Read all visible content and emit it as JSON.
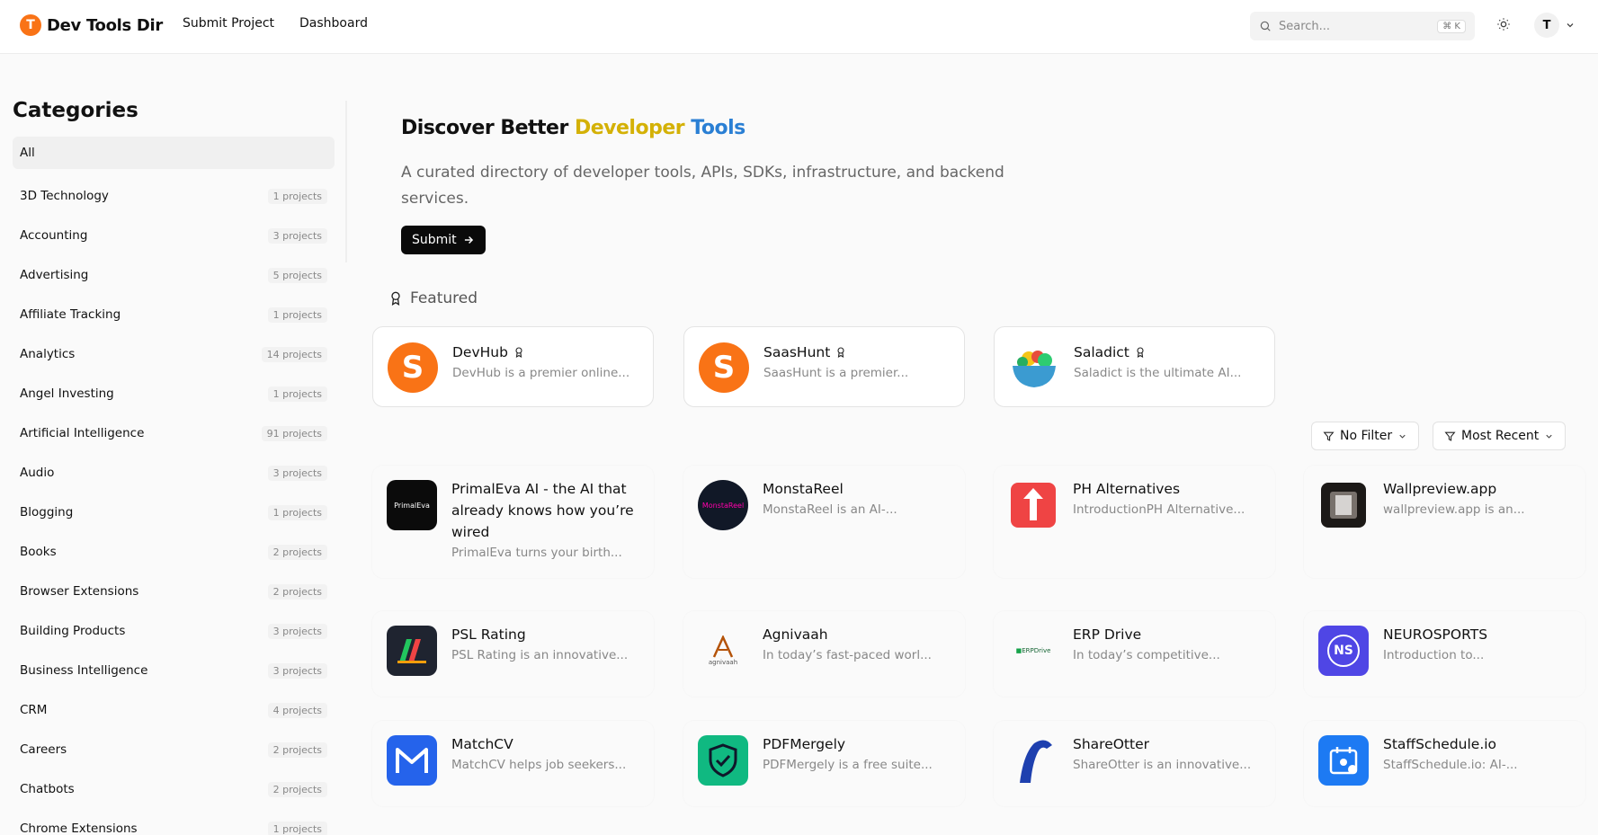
{
  "nav": {
    "logo_letter": "T",
    "logo_text": "Dev Tools Dir",
    "links": [
      "Submit Project",
      "Dashboard"
    ],
    "search_placeholder": "Search...",
    "search_shortcut": "⌘ K",
    "user_initial": "T"
  },
  "sidebar": {
    "title": "Categories",
    "items": [
      {
        "label": "All",
        "count": ""
      },
      {
        "label": "3D Technology",
        "count": "1 projects"
      },
      {
        "label": "Accounting",
        "count": "3 projects"
      },
      {
        "label": "Advertising",
        "count": "5 projects"
      },
      {
        "label": "Affiliate Tracking",
        "count": "1 projects"
      },
      {
        "label": "Analytics",
        "count": "14 projects"
      },
      {
        "label": "Angel Investing",
        "count": "1 projects"
      },
      {
        "label": "Artificial Intelligence",
        "count": "91 projects"
      },
      {
        "label": "Audio",
        "count": "3 projects"
      },
      {
        "label": "Blogging",
        "count": "1 projects"
      },
      {
        "label": "Books",
        "count": "2 projects"
      },
      {
        "label": "Browser Extensions",
        "count": "2 projects"
      },
      {
        "label": "Building Products",
        "count": "3 projects"
      },
      {
        "label": "Business Intelligence",
        "count": "3 projects"
      },
      {
        "label": "CRM",
        "count": "4 projects"
      },
      {
        "label": "Careers",
        "count": "2 projects"
      },
      {
        "label": "Chatbots",
        "count": "2 projects"
      },
      {
        "label": "Chrome Extensions",
        "count": "1 projects"
      }
    ]
  },
  "hero": {
    "title_plain": "Discover Better ",
    "title_word1": "Developer",
    "title_word2": " Tools",
    "subtitle": "A curated directory of developer tools, APIs, SDKs, infrastructure, and backend services.",
    "submit_label": "Submit"
  },
  "featured": {
    "label": "Featured",
    "items": [
      {
        "name": "DevHub",
        "desc": "DevHub is a premier online..."
      },
      {
        "name": "SaasHunt",
        "desc": "SaasHunt is a premier..."
      },
      {
        "name": "Saladict",
        "desc": "Saladict is the ultimate AI..."
      }
    ]
  },
  "filters": {
    "filter_label": "No Filter",
    "sort_label": "Most Recent"
  },
  "projects": [
    {
      "name": "PrimalEva AI - the AI that already knows how you’re wired",
      "desc": "PrimalEva turns your birth...",
      "icon_text": "PrimalEva"
    },
    {
      "name": "MonstaReel",
      "desc": "MonstaReel is an AI-...",
      "icon_text": "MonstaReel"
    },
    {
      "name": "PH Alternatives",
      "desc": "IntroductionPH Alternative...",
      "icon_text": ""
    },
    {
      "name": "Wallpreview.app",
      "desc": "wallpreview.app is an...",
      "icon_text": ""
    },
    {
      "name": "PSL Rating",
      "desc": "PSL Rating is an innovative...",
      "icon_text": ""
    },
    {
      "name": "Agnivaah",
      "desc": "In today’s fast-paced worl...",
      "icon_text": "agnivaah"
    },
    {
      "name": "ERP Drive",
      "desc": "In today’s competitive...",
      "icon_text": "ERPDrive"
    },
    {
      "name": "NEUROSPORTS",
      "desc": "Introduction to...",
      "icon_text": "NS"
    },
    {
      "name": "MatchCV",
      "desc": "MatchCV helps job seekers...",
      "icon_text": ""
    },
    {
      "name": "PDFMergely",
      "desc": "PDFMergely is a free suite...",
      "icon_text": ""
    },
    {
      "name": "ShareOtter",
      "desc": "ShareOtter is an innovative...",
      "icon_text": ""
    },
    {
      "name": "StaffSchedule.io",
      "desc": "StaffSchedule.io: AI-...",
      "icon_text": ""
    }
  ],
  "colors": {
    "accent_orange": "#f97316",
    "gradient_yellow": "#d4b106",
    "gradient_green": "#3aa57a",
    "gradient_blue": "#2a7fd4"
  }
}
